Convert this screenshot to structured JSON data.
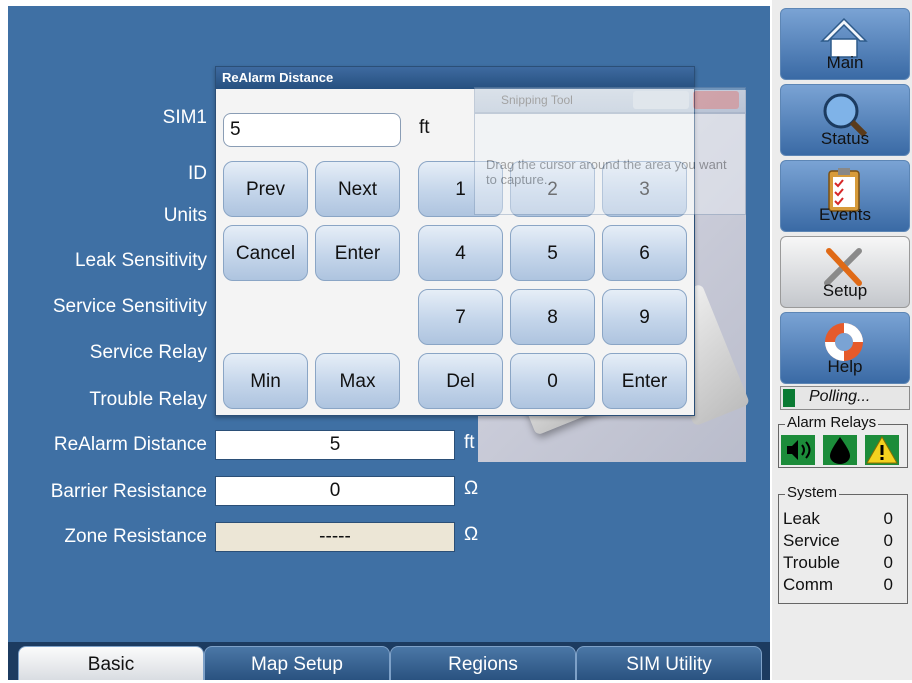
{
  "form": {
    "sim_label": "SIM1",
    "rows": [
      {
        "label": "ID"
      },
      {
        "label": "Units"
      },
      {
        "label": "Leak Sensitivity"
      },
      {
        "label": "Service Sensitivity"
      },
      {
        "label": "Service Relay"
      },
      {
        "label": "Trouble Relay"
      },
      {
        "label": "ReAlarm Distance",
        "value": "5",
        "unit": "ft"
      },
      {
        "label": "Barrier Resistance",
        "value": "0",
        "unit": "Ω"
      },
      {
        "label": "Zone Resistance",
        "value": "-----",
        "unit": "Ω"
      }
    ]
  },
  "dialog": {
    "title": "ReAlarm Distance",
    "input_value": "5",
    "unit": "ft",
    "buttons": {
      "prev": "Prev",
      "next": "Next",
      "cancel": "Cancel",
      "enter_left": "Enter",
      "min": "Min",
      "max": "Max",
      "del": "Del",
      "enter_right": "Enter",
      "digits": [
        "1",
        "2",
        "3",
        "4",
        "5",
        "6",
        "7",
        "8",
        "9",
        "0"
      ]
    }
  },
  "snipping_tool": {
    "title": "Snipping Tool",
    "hint": "Drag the cursor around the area you want to capture."
  },
  "tabs": [
    {
      "label": "Basic",
      "active": true
    },
    {
      "label": "Map Setup",
      "active": false
    },
    {
      "label": "Regions",
      "active": false
    },
    {
      "label": "SIM Utility",
      "active": false
    }
  ],
  "nav": [
    {
      "label": "Main",
      "icon": "house-icon",
      "active": false
    },
    {
      "label": "Status",
      "icon": "magnifier-icon",
      "active": false
    },
    {
      "label": "Events",
      "icon": "clipboard-icon",
      "active": false
    },
    {
      "label": "Setup",
      "icon": "tools-icon",
      "active": true
    },
    {
      "label": "Help",
      "icon": "lifebuoy-icon",
      "active": false
    }
  ],
  "status": {
    "polling_text": "Polling...",
    "alarm_relays_title": "Alarm Relays",
    "relays": [
      "speaker-icon",
      "drop-icon",
      "warning-icon"
    ],
    "system_title": "System",
    "system": [
      {
        "label": "Leak",
        "value": "0"
      },
      {
        "label": "Service",
        "value": "0"
      },
      {
        "label": "Trouble",
        "value": "0"
      },
      {
        "label": "Comm",
        "value": "0"
      }
    ]
  },
  "colors": {
    "panel_bg": "#3f70a4",
    "dialog_title_bg": "#26507f",
    "polling_led": "#0a7a33",
    "relay_green": "#1c8c3a",
    "relay_yellow": "#f4d21f"
  }
}
